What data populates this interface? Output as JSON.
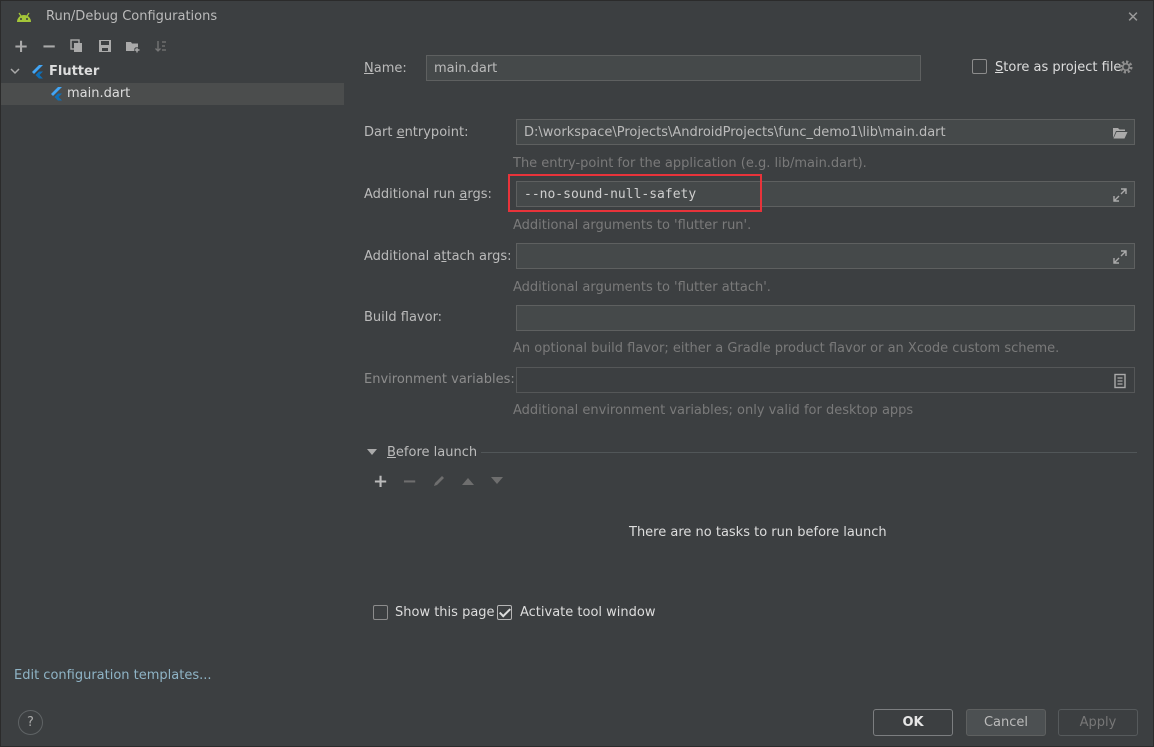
{
  "window": {
    "title": "Run/Debug Configurations",
    "close_glyph": "✕"
  },
  "toolbar": {
    "add_glyph": "+",
    "remove_glyph": "−"
  },
  "tree": {
    "group_label": "Flutter",
    "child_label": "main.dart"
  },
  "sidebar": {
    "edit_templates": "Edit configuration templates...",
    "help_glyph": "?"
  },
  "form": {
    "name_label_pre": "",
    "name_label_u": "N",
    "name_label_post": "ame:",
    "name_value": "main.dart",
    "store_label_pre": "",
    "store_label_u": "S",
    "store_label_post": "tore as project file",
    "store_checked": false,
    "entry_label_pre": "Dart ",
    "entry_label_u": "e",
    "entry_label_post": "ntrypoint:",
    "entry_value": "D:\\workspace\\Projects\\AndroidProjects\\func_demo1\\lib\\main.dart",
    "entry_hint": "The entry-point for the application (e.g. lib/main.dart).",
    "run_args_label_pre": "Additional run ",
    "run_args_label_u": "a",
    "run_args_label_post": "rgs:",
    "run_args_value": "--no-sound-null-safety",
    "run_args_hint": "Additional arguments to 'flutter run'.",
    "attach_label_pre": "Additional a",
    "attach_label_u": "t",
    "attach_label_post": "tach args:",
    "attach_value": "",
    "attach_hint": "Additional arguments to 'flutter attach'.",
    "flavor_label": "Build flavor:",
    "flavor_value": "",
    "flavor_hint": "An optional build flavor; either a Gradle product flavor or an Xcode custom scheme.",
    "env_label": "Environment variables:",
    "env_value": "",
    "env_hint": "Additional environment variables; only valid for desktop apps"
  },
  "before_launch": {
    "title_u": "B",
    "title_post": "efore launch",
    "add_glyph": "+",
    "remove_glyph": "−",
    "empty_message": "There are no tasks to run before launch"
  },
  "options": {
    "show_page_label": "Show this page",
    "show_page_checked": false,
    "activate_label": "Activate tool window",
    "activate_checked": true
  },
  "buttons": {
    "ok": "OK",
    "cancel": "Cancel",
    "apply": "Apply"
  },
  "colors": {
    "background": "#3c3f41",
    "highlight_border": "#e8333a",
    "flutter_blue": "#42a5f5",
    "android_green": "#a4c639"
  }
}
